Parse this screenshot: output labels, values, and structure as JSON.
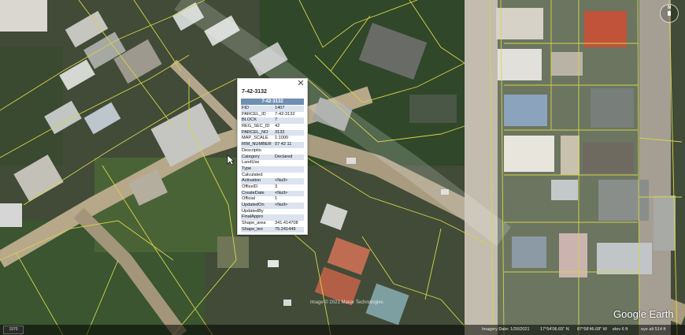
{
  "popup": {
    "title": "7-42-3132",
    "header": "7-42-3132",
    "close_icon": "close-icon",
    "rows": [
      {
        "k": "FID",
        "v": "1407"
      },
      {
        "k": "PARCEL_ID",
        "v": "7-42-3132"
      },
      {
        "k": "BLOCK",
        "v": "7"
      },
      {
        "k": "REG_SEC_ID",
        "v": "42"
      },
      {
        "k": "PARCEL_NO",
        "v": "3132"
      },
      {
        "k": "MAP_SCALE",
        "v": "1:1000"
      },
      {
        "k": "RIM_NUMBER",
        "v": "07 42 11"
      },
      {
        "k": "Descriptio",
        "v": ""
      },
      {
        "k": "Category",
        "v": "Declared"
      },
      {
        "k": "LandUse",
        "v": ""
      },
      {
        "k": "Type",
        "v": ""
      },
      {
        "k": "Calculated",
        "v": ""
      },
      {
        "k": "Activation",
        "v": "<Null>"
      },
      {
        "k": "OfficeID",
        "v": "3"
      },
      {
        "k": "CreateDate",
        "v": "<Null>"
      },
      {
        "k": "Official",
        "v": "1"
      },
      {
        "k": "UpdatedOn",
        "v": "<Null>"
      },
      {
        "k": "UpdatedBy",
        "v": ""
      },
      {
        "k": "FinalAppro",
        "v": ""
      },
      {
        "k": "Shape_area",
        "v": "341.414708"
      },
      {
        "k": "Shape_len",
        "v": "75.241449"
      }
    ]
  },
  "status_bar": {
    "tour_button": "1970",
    "imagery_date": "Imagery Date: 1/26/2021",
    "lat": "17°54'06.65\" N",
    "lon": "87°58'46.68\" W",
    "elev": "elev   6 ft",
    "eye_alt": "eye alt   514 ft"
  },
  "watermark": "Image © 2021 Maxar Technologies",
  "logo": "Google Earth",
  "nav_label": "N"
}
